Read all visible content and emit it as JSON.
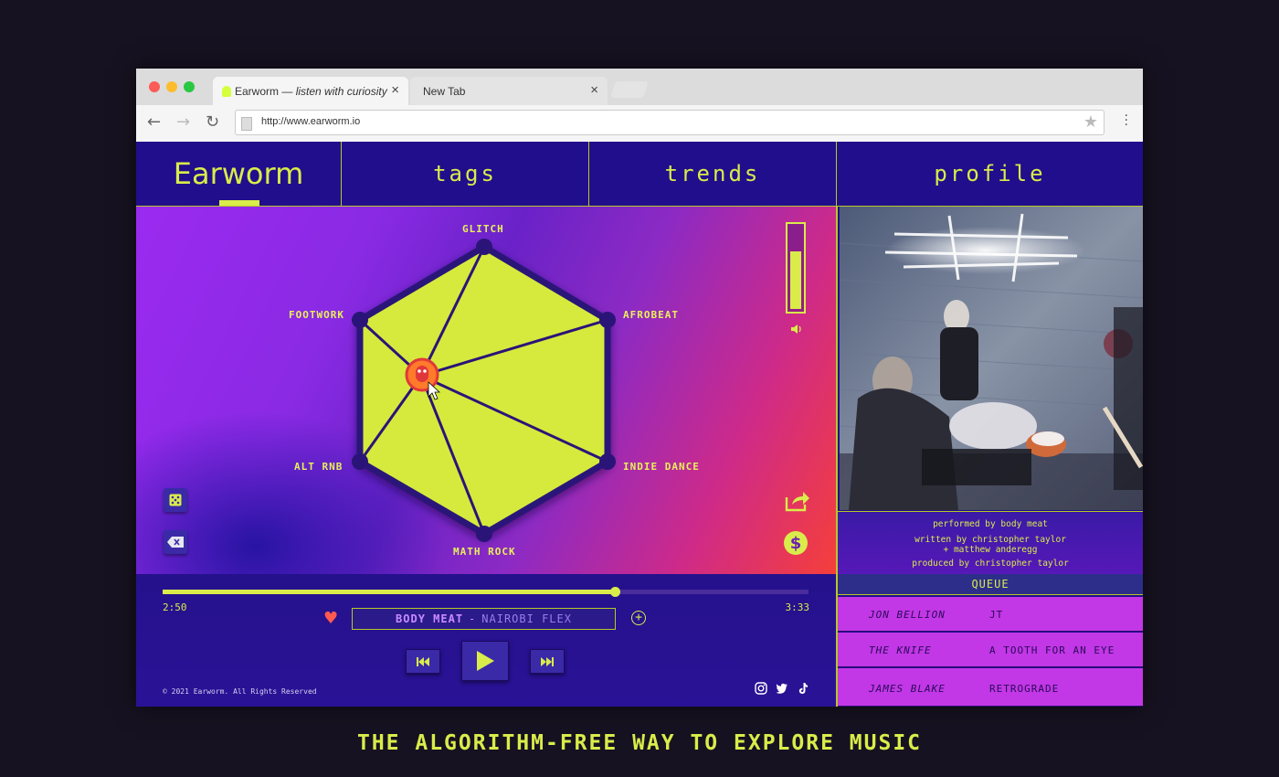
{
  "browser": {
    "tabs": [
      {
        "title": "Earworm — ",
        "subtitle": "listen with curiosity"
      },
      {
        "title": "New Tab"
      }
    ],
    "url": "http://www.earworm.io"
  },
  "nav": {
    "logo": "Earworm",
    "items": [
      "tags",
      "trends",
      "profile"
    ]
  },
  "genres": {
    "top": "GLITCH",
    "top_right": "AFROBEAT",
    "bottom_right": "INDIE DANCE",
    "bottom": "MATH ROCK",
    "bottom_left": "ALT RNB",
    "top_left": "FOOTWORK"
  },
  "volume_level": 0.72,
  "player": {
    "elapsed": "2:50",
    "duration": "3:33",
    "progress": 0.7,
    "artist": "BODY MEAT",
    "separator": "-",
    "track": "NAIROBI FLEX"
  },
  "footer": {
    "copyright": "© 2021 Earworm. All Rights Reserved"
  },
  "credits": {
    "performed": "performed by body meat",
    "written": "written by christopher taylor",
    "written2": "+ matthew anderegg",
    "produced": "produced by christopher taylor"
  },
  "queue": {
    "title": "QUEUE",
    "items": [
      {
        "artist": "JON BELLION",
        "song": "JT"
      },
      {
        "artist": "THE KNIFE",
        "song": "A TOOTH FOR AN EYE"
      },
      {
        "artist": "JAMES BLAKE",
        "song": "RETROGRADE"
      }
    ]
  },
  "tagline": "THE ALGORITHM-FREE WAY TO EXPLORE MUSIC",
  "colors": {
    "accent": "#d9ec4a",
    "navy": "#210e8c",
    "magenta": "#c237e6"
  }
}
